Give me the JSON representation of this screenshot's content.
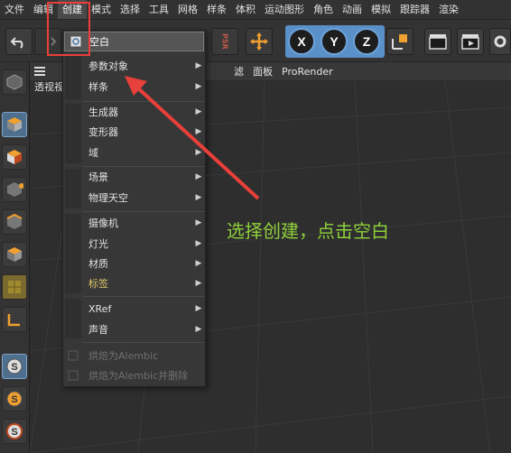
{
  "menubar": {
    "items": [
      "文件",
      "编辑",
      "创建",
      "模式",
      "选择",
      "工具",
      "网格",
      "样条",
      "体积",
      "运动图形",
      "角色",
      "动画",
      "模拟",
      "跟踪器",
      "渲染"
    ]
  },
  "toolbar": {
    "axis_x": "X",
    "axis_y": "Y",
    "axis_z": "Z",
    "psr_label": "PSR"
  },
  "viewport": {
    "label": "透视视",
    "tabs": [
      "滤",
      "面板",
      "ProRender"
    ]
  },
  "dropdown": {
    "top_item": "空白",
    "items": [
      {
        "label": "参数对象",
        "submenu": true
      },
      {
        "label": "样条",
        "submenu": true
      },
      {
        "label": "生成器",
        "submenu": true
      },
      {
        "label": "变形器",
        "submenu": true
      },
      {
        "label": "域",
        "submenu": true
      },
      {
        "label": "场景",
        "submenu": true
      },
      {
        "label": "物理天空",
        "submenu": true
      },
      {
        "label": "摄像机",
        "submenu": true
      },
      {
        "label": "灯光",
        "submenu": true
      },
      {
        "label": "材质",
        "submenu": true
      },
      {
        "label": "标签",
        "submenu": true
      },
      {
        "label": "XRef",
        "submenu": true
      },
      {
        "label": "声音",
        "submenu": true
      },
      {
        "label": "烘焙为Alembic",
        "submenu": false
      },
      {
        "label": "烘焙为Alembic并删除",
        "submenu": false
      }
    ]
  },
  "annotation": {
    "text": "选择创建，点击空白"
  },
  "colors": {
    "annotation": "#8fd03a",
    "highlight_box": "#e8403a",
    "axis_accent": "#5a90c8",
    "tag_label": "#e2c86a"
  }
}
